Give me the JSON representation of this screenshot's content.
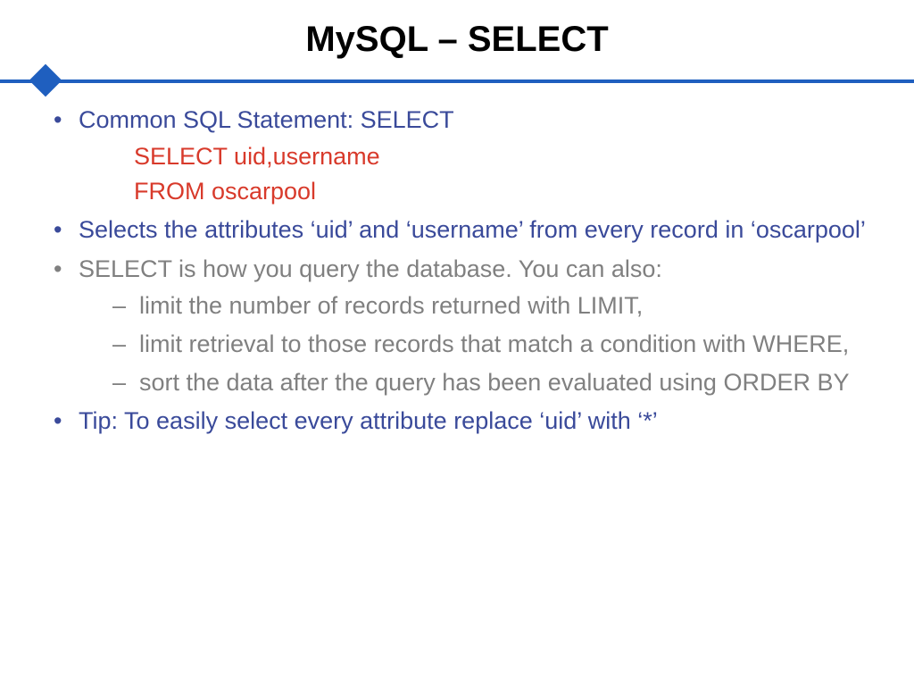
{
  "title": "MySQL – SELECT",
  "bullets": {
    "b1": "Common SQL Statement: SELECT",
    "code1": "SELECT uid,username",
    "code2": "FROM oscarpool",
    "b2": "Selects the attributes ‘uid’ and ‘username’ from every record in ‘oscarpool’",
    "b3": "SELECT is how you query the database. You can also:",
    "sub1": "limit the number of records returned with LIMIT,",
    "sub2": "limit retrieval to those records that match a condition with WHERE,",
    "sub3": "sort the data after the query has been evaluated using ORDER BY",
    "b4": "Tip: To easily select every attribute replace ‘uid’ with ‘*’"
  }
}
